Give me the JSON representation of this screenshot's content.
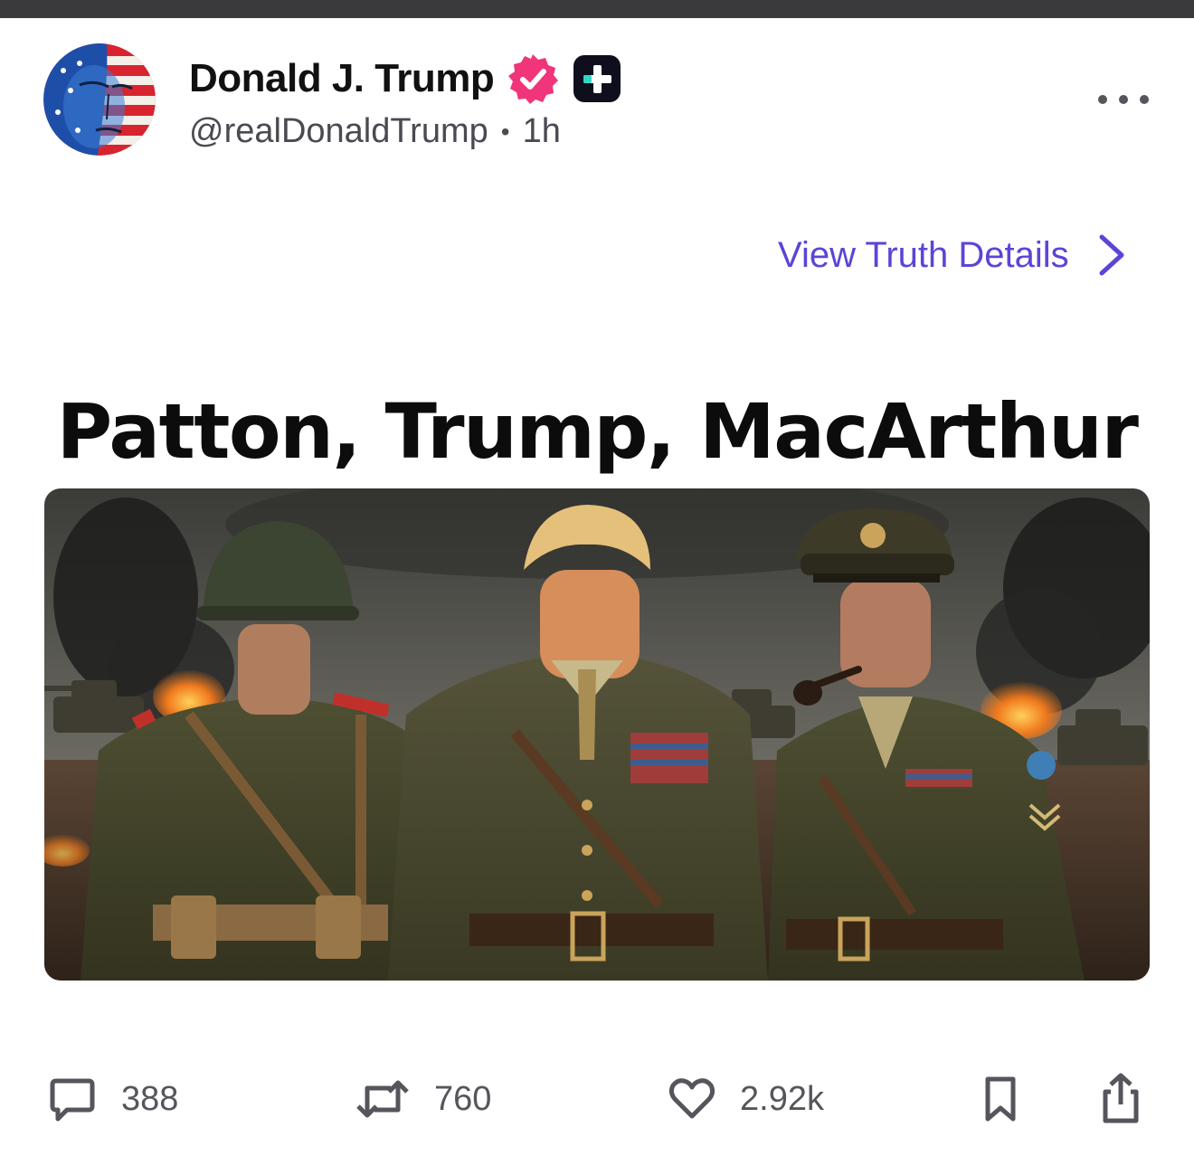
{
  "post": {
    "display_name": "Donald J. Trump",
    "handle": "@realDonaldTrump",
    "separator": "•",
    "time_ago": "1h",
    "details_link": "View Truth Details",
    "headline": "Patton, Trump, MacArthur",
    "image_alt": "Three men in World War II era military uniforms standing in front of a battlefield with tanks and smoke"
  },
  "icons": {
    "avatar": "flag-portrait-avatar",
    "verified": "verified-badge-icon",
    "plus": "truth-plus-icon",
    "more": "more-options-icon",
    "chevron": "chevron-right-icon",
    "reply": "reply-icon",
    "retruth": "retruth-icon",
    "like": "heart-icon",
    "bookmark": "bookmark-icon",
    "share": "share-icon"
  },
  "actions": {
    "replies": "388",
    "retruths": "760",
    "likes": "2.92k"
  },
  "colors": {
    "accent": "#5a45d6",
    "verified": "#f0357a",
    "text": "#111111",
    "muted": "#4a4a52",
    "top_bar": "#3a3a3c"
  }
}
